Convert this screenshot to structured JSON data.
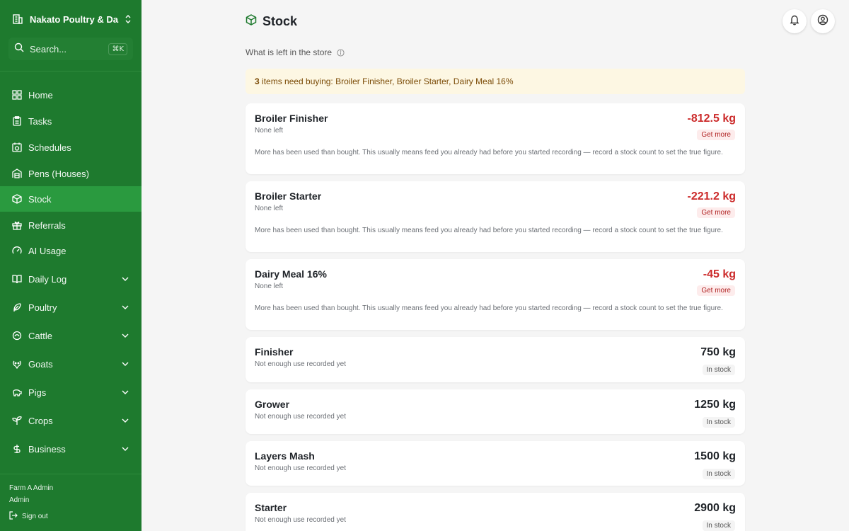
{
  "sidebar": {
    "farm_name": "Nakato Poultry & Da...",
    "search_label": "Search...",
    "search_shortcut": "⌘K",
    "items": [
      {
        "label": "Home"
      },
      {
        "label": "Tasks"
      },
      {
        "label": "Schedules"
      },
      {
        "label": "Pens (Houses)"
      },
      {
        "label": "Stock",
        "active": true
      },
      {
        "label": "Referrals"
      },
      {
        "label": "AI Usage"
      },
      {
        "label": "Daily Log",
        "expandable": true
      },
      {
        "label": "Poultry",
        "expandable": true
      },
      {
        "label": "Cattle",
        "expandable": true
      },
      {
        "label": "Goats",
        "expandable": true
      },
      {
        "label": "Pigs",
        "expandable": true
      },
      {
        "label": "Crops",
        "expandable": true
      },
      {
        "label": "Business",
        "expandable": true
      }
    ],
    "user_name": "Farm A Admin",
    "user_role": "Admin",
    "sign_out": "Sign out"
  },
  "page": {
    "title": "Stock",
    "subtitle": "What is left in the store"
  },
  "alert": {
    "count": "3",
    "text": " items need buying: Broiler Finisher, Broiler Starter, Dairy Meal 16%"
  },
  "stock_items": [
    {
      "name": "Broiler Finisher",
      "status": "None left",
      "quantity": "-812.5 kg",
      "badge": "Get more",
      "note": "More has been used than bought. This usually means feed you already had before you started recording — record a stock count to set the true figure."
    },
    {
      "name": "Broiler Starter",
      "status": "None left",
      "quantity": "-221.2 kg",
      "badge": "Get more",
      "note": "More has been used than bought. This usually means feed you already had before you started recording — record a stock count to set the true figure."
    },
    {
      "name": "Dairy Meal 16%",
      "status": "None left",
      "quantity": "-45 kg",
      "badge": "Get more",
      "note": "More has been used than bought. This usually means feed you already had before you started recording — record a stock count to set the true figure."
    },
    {
      "name": "Finisher",
      "status": "Not enough use recorded yet",
      "quantity": "750 kg",
      "badge": "In stock"
    },
    {
      "name": "Grower",
      "status": "Not enough use recorded yet",
      "quantity": "1250 kg",
      "badge": "In stock"
    },
    {
      "name": "Layers Mash",
      "status": "Not enough use recorded yet",
      "quantity": "1500 kg",
      "badge": "In stock"
    },
    {
      "name": "Starter",
      "status": "Not enough use recorded yet",
      "quantity": "2900 kg",
      "badge": "In stock"
    }
  ],
  "colors": {
    "sidebar": "#1e7a2e",
    "active_item": "#2a9a3f",
    "negative": "#cc2b2b",
    "alert_bg": "#fdf7e3"
  }
}
